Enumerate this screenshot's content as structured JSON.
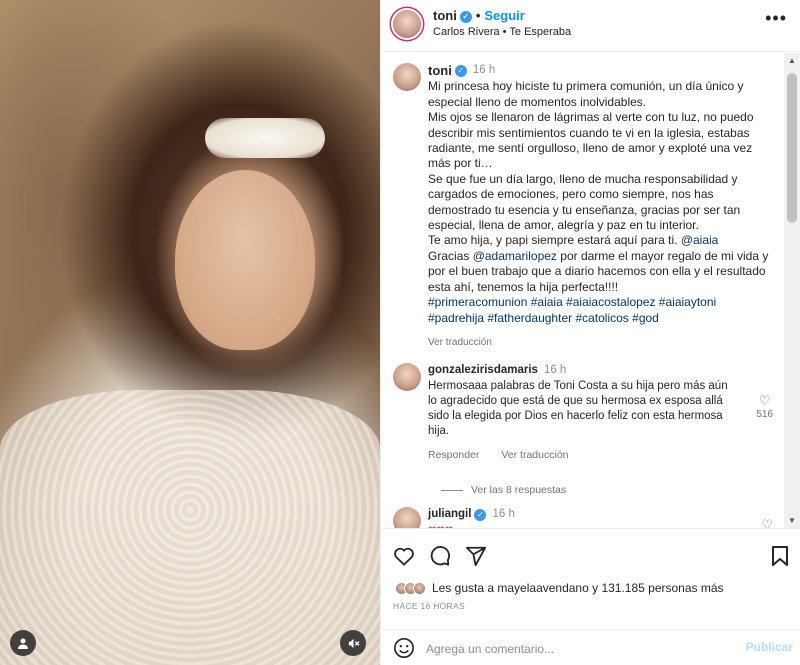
{
  "post": {
    "author": "toni",
    "follow_label": "Seguir",
    "audio": "Carlos Rivera • Te Esperaba",
    "more_label": "•••"
  },
  "caption": {
    "author": "toni",
    "time": "16 h",
    "p1": "Mi princesa hoy hiciste tu primera comunión, un día único y especial lleno de momentos inolvidables.",
    "p2": "Mis ojos se llenaron de lágrimas al verte con tu luz, no puedo describir mis sentimientos cuando te vi en la iglesia, estabas radiante, me sentí orgulloso, lleno de amor y exploté una vez más por ti…",
    "p3": "Se que fue un día largo, lleno de mucha responsabilidad y cargados de emociones, pero como siempre, nos has demostrado tu esencia y tu enseñanza, gracias por ser tan especial, llena de amor, alegría y paz en tu interior.",
    "p4a": "Te amo hija, y papi siempre estará aquí para ti.",
    "p4_mention": "@aiaia",
    "p5a": "Gracias",
    "p5_mention": "@adamarilopez",
    "p5b": "por darme el mayor regalo de mi vida y por el buen trabajo que a diario hacemos con ella y el resultado esta ahí, tenemos la hija perfecta!!!!",
    "hashtags": "#primeracomunion #aiaia #aiaiacostalopez #aiaiaytoni #padrehija #fatherdaughter #catolicos #god",
    "translate": "Ver traducción"
  },
  "comments": [
    {
      "author": "gonzalezirisdamaris",
      "time": "16 h",
      "text": "Hermosaaa palabras de Toni Costa a su hija pero más aún lo agradecido que está de que su hermosa ex esposa allá sido la elegida por Dios en hacerlo feliz con esta hermosa hija.",
      "reply": "Responder",
      "translate": "Ver traducción",
      "likes": "516",
      "replies": "Ver las 8 respuestas"
    },
    {
      "author": "juliangil",
      "time": "16 h",
      "text": "❤❤❤"
    }
  ],
  "footer": {
    "likes_text": "Les gusta a mayelaavendano y 131.185 personas más",
    "ago": "HACE 16 HORAS",
    "comment_placeholder": "Agrega un comentario...",
    "publish": "Publicar"
  },
  "colors": {
    "accent": "#0095f6",
    "link": "#00376b",
    "muted": "#8e8e8e"
  }
}
